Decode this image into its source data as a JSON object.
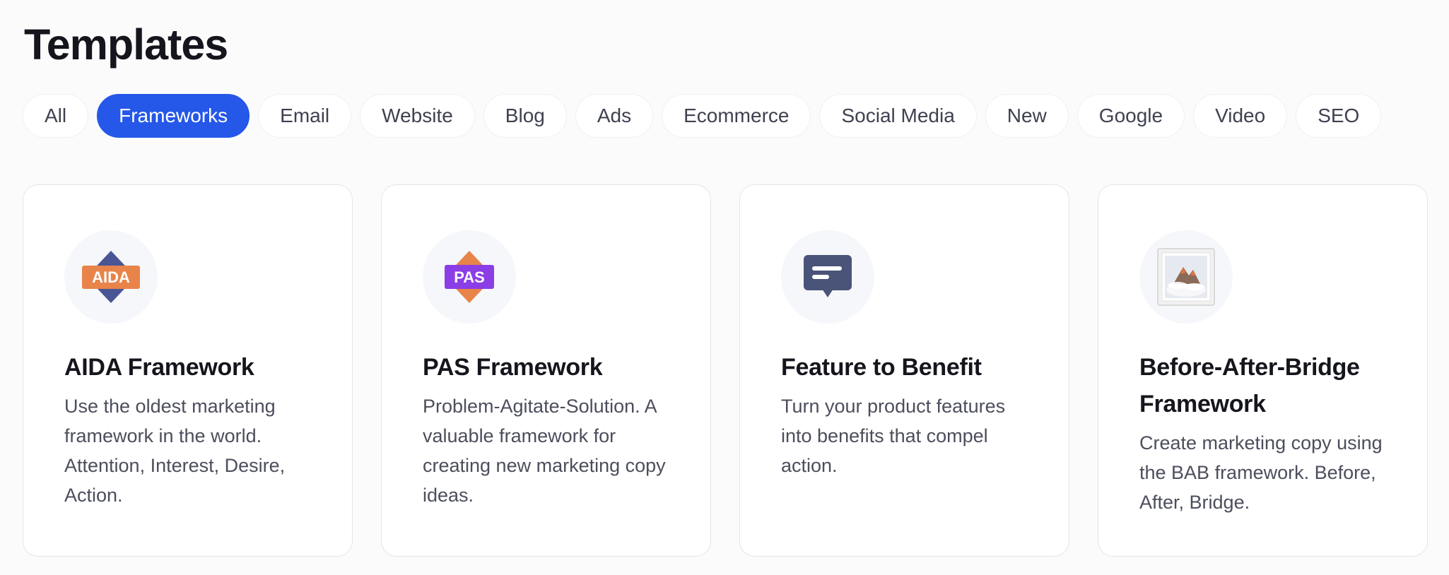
{
  "page": {
    "title": "Templates"
  },
  "tabs": [
    {
      "label": "All",
      "active": false
    },
    {
      "label": "Frameworks",
      "active": true
    },
    {
      "label": "Email",
      "active": false
    },
    {
      "label": "Website",
      "active": false
    },
    {
      "label": "Blog",
      "active": false
    },
    {
      "label": "Ads",
      "active": false
    },
    {
      "label": "Ecommerce",
      "active": false
    },
    {
      "label": "Social Media",
      "active": false
    },
    {
      "label": "New",
      "active": false
    },
    {
      "label": "Google",
      "active": false
    },
    {
      "label": "Video",
      "active": false
    },
    {
      "label": "SEO",
      "active": false
    }
  ],
  "cards": [
    {
      "icon": "aida-badge-icon",
      "icon_text": "AIDA",
      "title": "AIDA Framework",
      "description": "Use the oldest marketing framework in the world. Attention, Interest, Desire, Action."
    },
    {
      "icon": "pas-badge-icon",
      "icon_text": "PAS",
      "title": "PAS Framework",
      "description": "Problem-Agitate-Solution. A valuable framework for creating new marketing copy ideas."
    },
    {
      "icon": "speech-bubble-icon",
      "title": "Feature to Benefit",
      "description": "Turn your product features into benefits that compel action."
    },
    {
      "icon": "framed-picture-icon",
      "title": "Before-After-Bridge Framework",
      "description": "Create marketing copy using the BAB framework. Before, After, Bridge."
    }
  ],
  "colors": {
    "accent": "#2557e8",
    "aida_orange": "#e8844a",
    "aida_navy": "#4a5694",
    "pas_purple": "#8b3ee6",
    "pas_orange": "#e8844a",
    "bubble_slate": "#4a5478"
  }
}
